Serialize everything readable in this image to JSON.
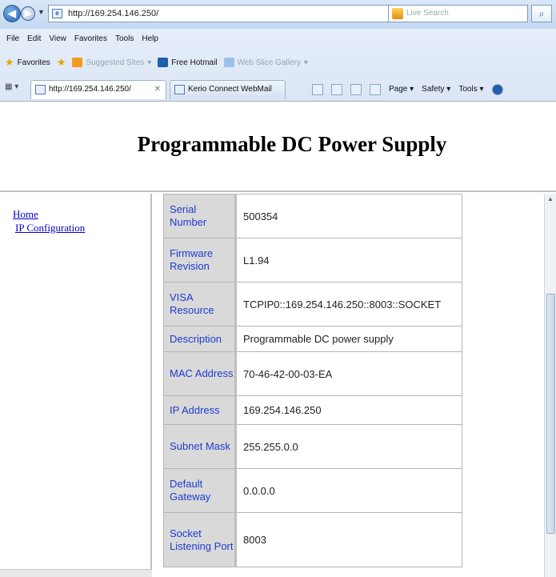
{
  "browser": {
    "address": "http://169.254.146.250/",
    "search_placeholder": "Live Search",
    "menu": [
      "File",
      "Edit",
      "View",
      "Favorites",
      "Tools",
      "Help"
    ],
    "favorites_label": "Favorites",
    "favorites_items": [
      {
        "label": "Suggested Sites",
        "dim": true
      },
      {
        "label": "Free Hotmail",
        "dim": false
      },
      {
        "label": "Web Slice Gallery",
        "dim": true
      }
    ],
    "tabs": [
      {
        "label": "http://169.254.146.250/"
      },
      {
        "label": "Kerio Connect WebMail"
      }
    ],
    "command_bar": [
      "Page",
      "Safety",
      "Tools"
    ]
  },
  "page": {
    "title": "Programmable DC Power Supply",
    "nav": {
      "home": "Home",
      "ip_config": "IP Configuration"
    },
    "info": [
      {
        "label": "Serial Number",
        "value": "500354"
      },
      {
        "label": "Firmware Revision",
        "value": "L1.94"
      },
      {
        "label": "VISA Resource",
        "value": "TCPIP0::169.254.146.250::8003::SOCKET"
      },
      {
        "label": "Description",
        "value": "Programmable DC power supply"
      },
      {
        "label": "MAC Address",
        "value": "70-46-42-00-03-EA"
      },
      {
        "label": "IP Address",
        "value": "169.254.146.250"
      },
      {
        "label": "Subnet Mask",
        "value": "255.255.0.0"
      },
      {
        "label": "Default Gateway",
        "value": "0.0.0.0"
      },
      {
        "label": "Socket Listening Port",
        "value": "8003"
      }
    ]
  }
}
